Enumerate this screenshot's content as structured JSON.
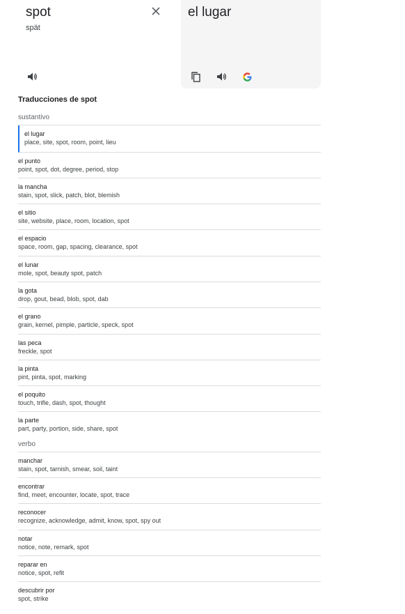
{
  "source": {
    "word": "spot",
    "phonetic": "spät",
    "clear_icon": "close-icon",
    "speaker_icon": "speaker-icon"
  },
  "target": {
    "word": "el lugar",
    "copy_icon": "copy-icon",
    "speaker_icon": "speaker-icon",
    "google_icon": "google-icon"
  },
  "translations": {
    "title": "Traducciones de spot",
    "noun": {
      "label": "sustantivo",
      "entries": [
        {
          "term": "el lugar",
          "synonyms": "place, site, spot, room, point, lieu",
          "selected": true
        },
        {
          "term": "el punto",
          "synonyms": "point, spot, dot, degree, period, stop"
        },
        {
          "term": "la mancha",
          "synonyms": "stain, spot, slick, patch, blot, blemish"
        },
        {
          "term": "el sitio",
          "synonyms": "site, website, place, room, location, spot"
        },
        {
          "term": "el espacio",
          "synonyms": "space, room, gap, spacing, clearance, spot"
        },
        {
          "term": "el lunar",
          "synonyms": "mole, spot, beauty spot, patch"
        },
        {
          "term": "la gota",
          "synonyms": "drop, gout, bead, blob, spot, dab"
        },
        {
          "term": "el grano",
          "synonyms": "grain, kernel, pimple, particle, speck, spot"
        },
        {
          "term": "las peca",
          "synonyms": "freckle, spot"
        },
        {
          "term": "la pinta",
          "synonyms": "pint, pinta, spot, marking"
        },
        {
          "term": "el poquito",
          "synonyms": "touch, trifle, dash, spot, thought"
        },
        {
          "term": "la parte",
          "synonyms": "part, party, portion, side, share, spot"
        }
      ]
    },
    "verb": {
      "label": "verbo",
      "entries": [
        {
          "term": "manchar",
          "synonyms": "stain, spot, tarnish, smear, soil, taint"
        },
        {
          "term": "encontrar",
          "synonyms": "find, meet, encounter, locate, spot, trace"
        },
        {
          "term": "reconocer",
          "synonyms": "recognize, acknowledge, admit, know, spot, spy out"
        },
        {
          "term": "notar",
          "synonyms": "notice, note, remark, spot"
        },
        {
          "term": "reparar en",
          "synonyms": "notice, spot, refit"
        },
        {
          "term": "descubrir por",
          "synonyms": "spot, strike"
        }
      ]
    }
  }
}
